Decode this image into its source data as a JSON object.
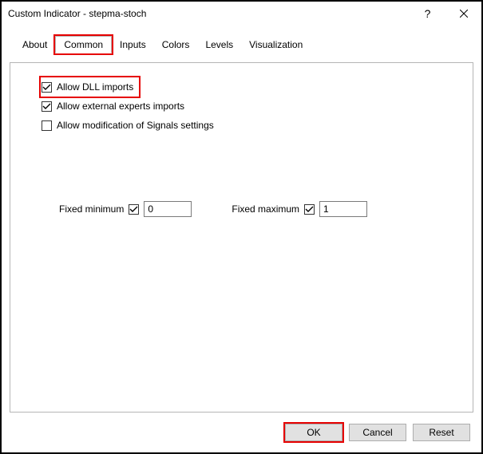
{
  "window": {
    "title": "Custom Indicator - stepma-stoch"
  },
  "tabs": {
    "about": "About",
    "common": "Common",
    "inputs": "Inputs",
    "colors": "Colors",
    "levels": "Levels",
    "visualization": "Visualization"
  },
  "options": {
    "allow_dll": {
      "label": "Allow DLL imports",
      "checked": true
    },
    "allow_external": {
      "label": "Allow external experts imports",
      "checked": true
    },
    "allow_signals": {
      "label": "Allow modification of Signals settings",
      "checked": false
    }
  },
  "minmax": {
    "min_label": "Fixed minimum",
    "min_checked": true,
    "min_value": "0",
    "max_label": "Fixed maximum",
    "max_checked": true,
    "max_value": "1"
  },
  "buttons": {
    "ok": "OK",
    "cancel": "Cancel",
    "reset": "Reset"
  }
}
